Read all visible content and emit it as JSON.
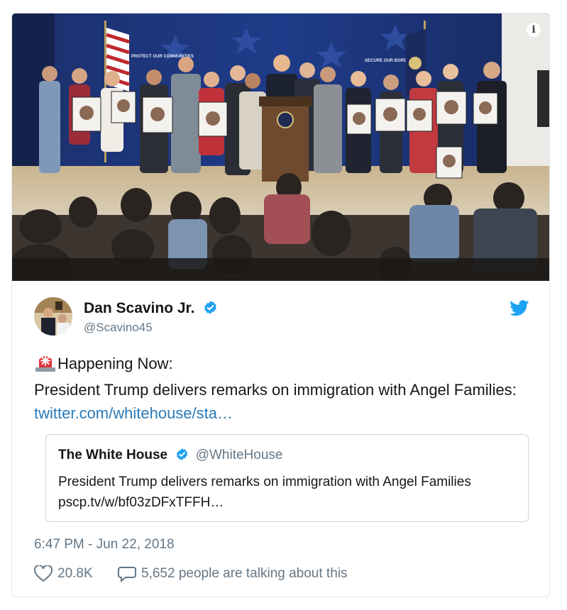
{
  "tweet": {
    "author_name": "Dan Scavino Jr.",
    "author_handle": "@Scavino45",
    "text_line1": "Happening Now:",
    "text_body": "President Trump delivers remarks on immigration with Angel Families: ",
    "link_text": "twitter.com/whitehouse/sta…",
    "timestamp": "6:47 PM - Jun 22, 2018",
    "likes": "20.8K",
    "talking": "5,652 people are talking about this"
  },
  "quote": {
    "author_name": "The White House",
    "author_handle": "@WhiteHouse",
    "text": "President Trump delivers remarks on immigration with Angel Families",
    "link_text": "pscp.tv/w/bf03zDFxTFFH…"
  },
  "media": {
    "banner_left": "PROTECT OUR COMMUNITIES",
    "banner_right": "SECURE OUR BORDERS",
    "info_icon_glyph": "i"
  },
  "icons": {
    "siren": "siren-icon",
    "verified": "verified-badge-icon",
    "twitter": "twitter-bird-icon",
    "heart": "heart-icon",
    "comment": "comment-bubble-icon",
    "info": "info-icon"
  },
  "colors": {
    "link": "#2b7bb9",
    "verified": "#1da1f2",
    "secondary_text": "#657786",
    "border": "#e1e8ed"
  }
}
